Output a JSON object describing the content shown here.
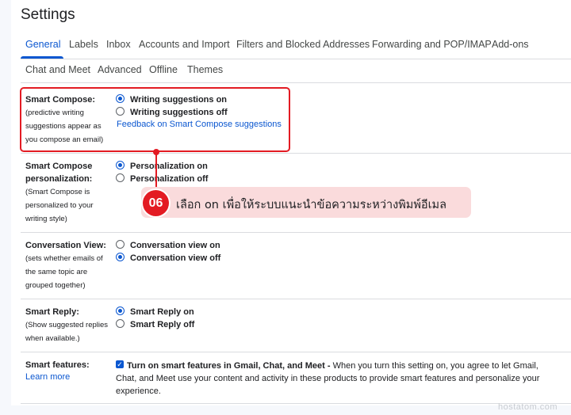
{
  "page_title": "Settings",
  "tabs_row1": [
    "General",
    "Labels",
    "Inbox",
    "Accounts and Import",
    "Filters and Blocked Addresses",
    "Forwarding and POP/IMAP",
    "Add-ons"
  ],
  "tabs_row2": [
    "Chat and Meet",
    "Advanced",
    "Offline",
    "Themes"
  ],
  "active_tab": "General",
  "sections": {
    "smart_compose": {
      "title": "Smart Compose:",
      "desc": [
        "(predictive writing",
        "suggestions appear as",
        "you compose an email)"
      ],
      "options": [
        "Writing suggestions on",
        "Writing suggestions off"
      ],
      "selected": 0,
      "link": "Feedback on Smart Compose suggestions"
    },
    "personalization": {
      "title": [
        "Smart Compose",
        "personalization:"
      ],
      "desc": [
        "(Smart Compose is",
        "personalized to your",
        "writing style)"
      ],
      "options": [
        "Personalization on",
        "Personalization off"
      ],
      "selected": 0
    },
    "conversation_view": {
      "title": "Conversation View:",
      "desc": [
        "(sets whether emails of",
        "the same topic are",
        "grouped together)"
      ],
      "options": [
        "Conversation view on",
        "Conversation view off"
      ],
      "selected": 1
    },
    "smart_reply": {
      "title": "Smart Reply:",
      "desc": [
        "(Show suggested replies",
        "when available.)"
      ],
      "options": [
        "Smart Reply on",
        "Smart Reply off"
      ],
      "selected": 0
    },
    "smart_features": {
      "title": "Smart features:",
      "link": "Learn more",
      "checked": true,
      "option_bold": "Turn on smart features in Gmail, Chat, and Meet -",
      "option_text": " When you turn this setting on, you agree to let Gmail, Chat, and Meet use your content and activity in these products to provide smart features and personalize your experience."
    }
  },
  "annotation": {
    "step": "06",
    "text": "เลือก on เพื่อให้ระบบแนะนำข้อความระหว่างพิมพ์อีเมล",
    "color": "#e31b23",
    "bg": "#fadbdc"
  },
  "watermark": "hostatom.com",
  "colors": {
    "accent": "#0b57d0",
    "annotation": "#e31b23"
  }
}
